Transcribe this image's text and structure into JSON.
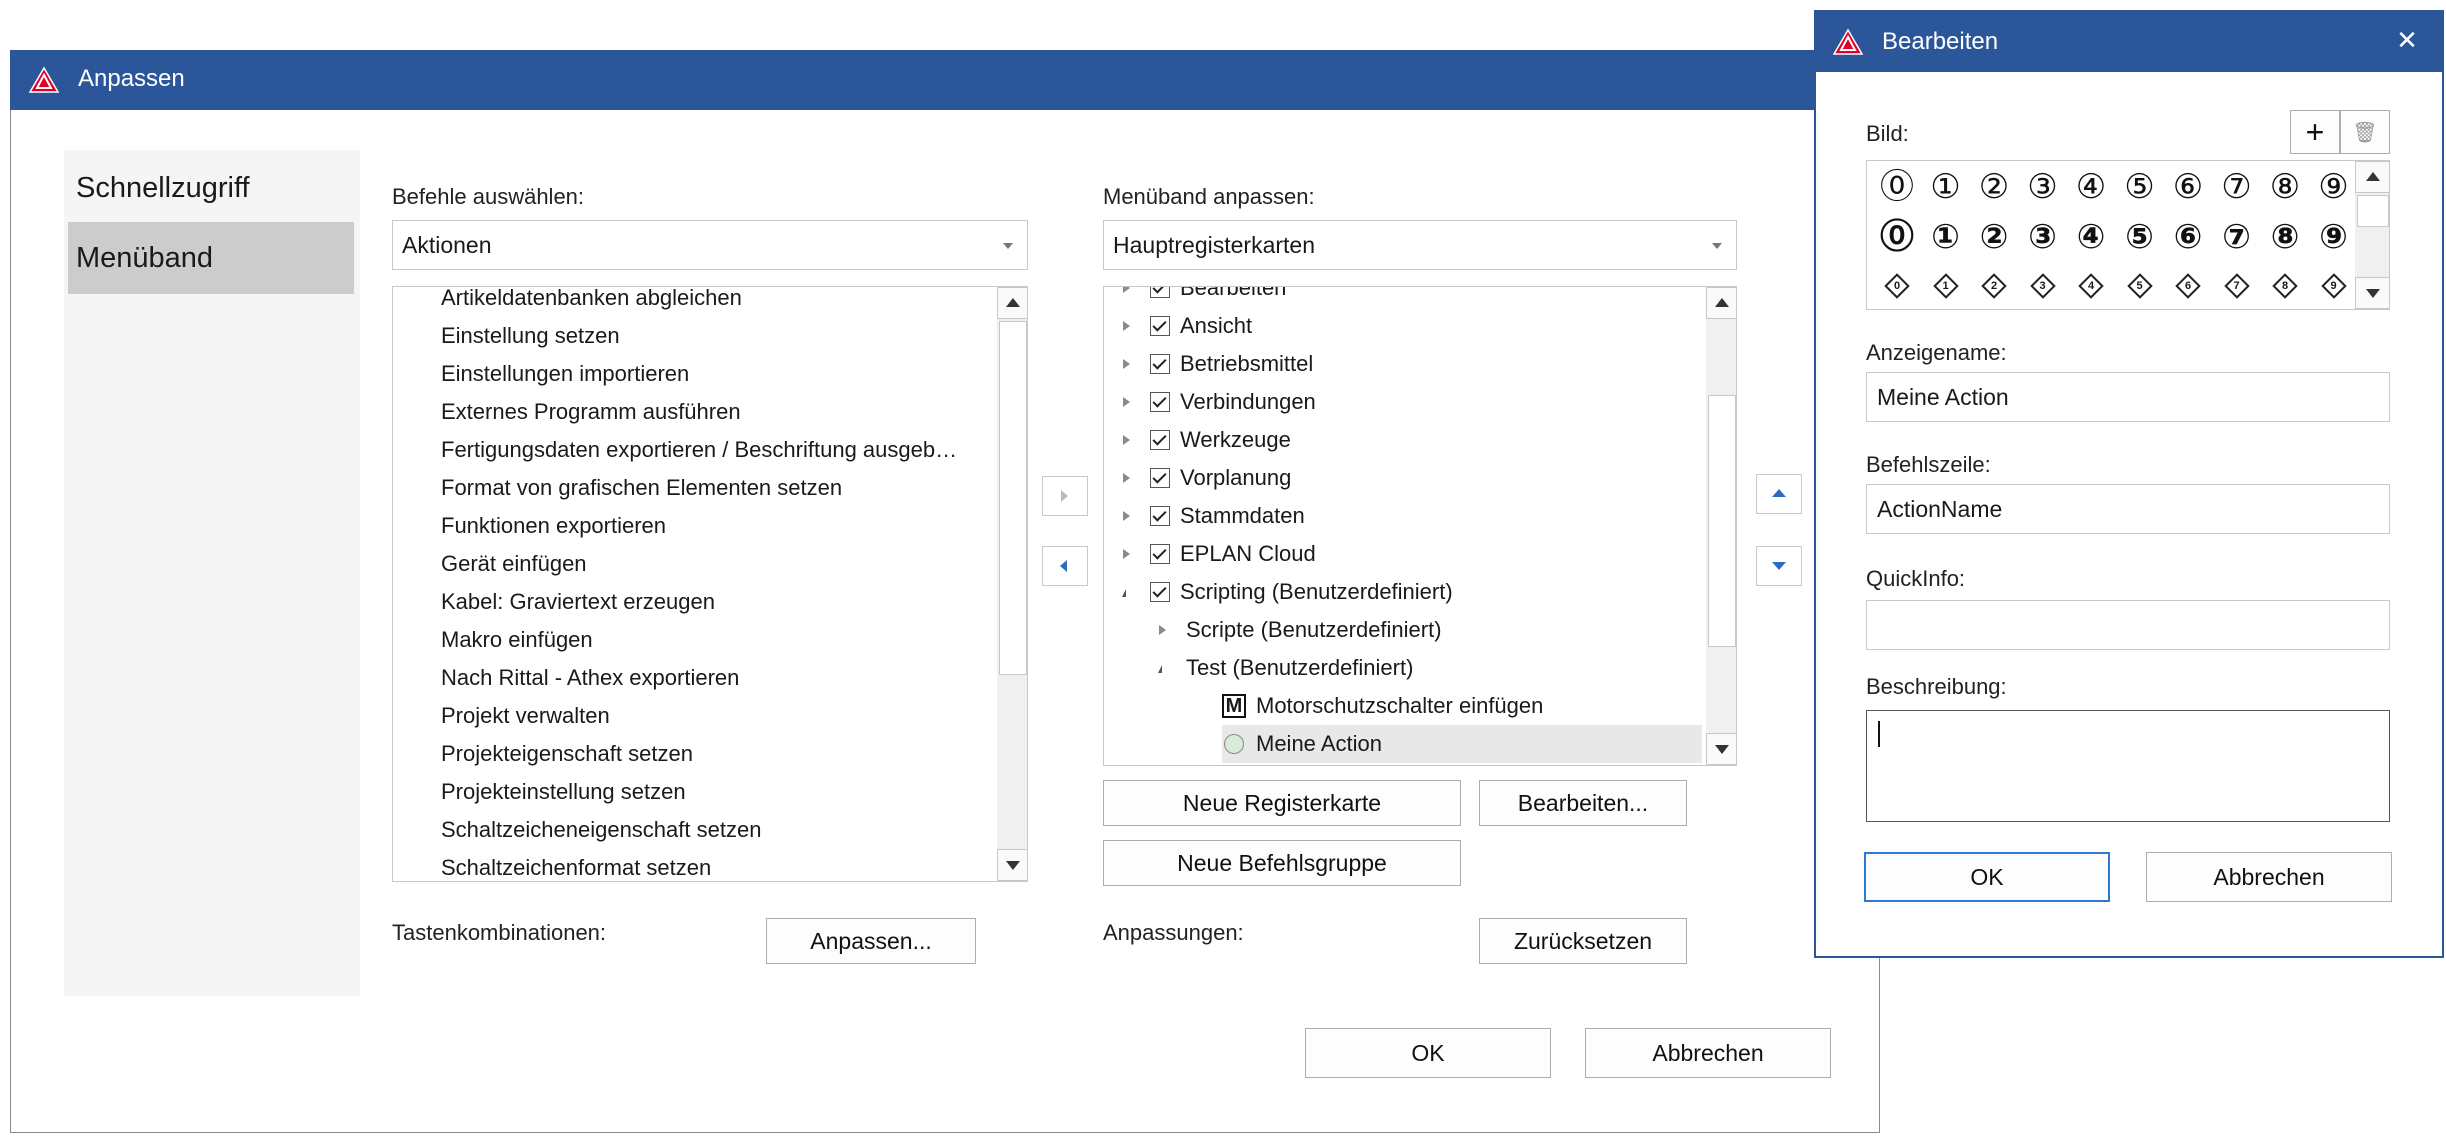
{
  "main_dialog": {
    "title": "Anpassen",
    "nav": [
      {
        "label": "Schnellzugriff",
        "selected": false
      },
      {
        "label": "Menüband",
        "selected": true
      }
    ],
    "commands": {
      "label": "Befehle auswählen:",
      "combo_value": "Aktionen",
      "items": [
        "Artikeldatenbanken abgleichen",
        "Einstellung setzen",
        "Einstellungen importieren",
        "Externes Programm ausführen",
        "Fertigungsdaten exportieren / Beschriftung ausgeb…",
        "Format von grafischen Elementen setzen",
        "Funktionen exportieren",
        "Gerät einfügen",
        "Kabel: Graviertext erzeugen",
        "Makro einfügen",
        "Nach Rittal - Athex exportieren",
        "Projekt verwalten",
        "Projekteigenschaft setzen",
        "Projekteinstellung setzen",
        "Schaltzeicheneigenschaft setzen",
        "Schaltzeichenformat setzen"
      ]
    },
    "ribbon": {
      "label": "Menüband anpassen:",
      "combo_value": "Hauptregisterkarten",
      "tree": [
        {
          "label": "Bearbeiten",
          "level": 0,
          "expander": "closed",
          "checked": true
        },
        {
          "label": "Ansicht",
          "level": 0,
          "expander": "closed",
          "checked": true
        },
        {
          "label": "Betriebsmittel",
          "level": 0,
          "expander": "closed",
          "checked": true
        },
        {
          "label": "Verbindungen",
          "level": 0,
          "expander": "closed",
          "checked": true
        },
        {
          "label": "Werkzeuge",
          "level": 0,
          "expander": "closed",
          "checked": true
        },
        {
          "label": "Vorplanung",
          "level": 0,
          "expander": "closed",
          "checked": true
        },
        {
          "label": "Stammdaten",
          "level": 0,
          "expander": "closed",
          "checked": true
        },
        {
          "label": "EPLAN Cloud",
          "level": 0,
          "expander": "closed",
          "checked": true
        },
        {
          "label": "Scripting (Benutzerdefiniert)",
          "level": 0,
          "expander": "open",
          "checked": true
        },
        {
          "label": "Scripte (Benutzerdefiniert)",
          "level": 1,
          "expander": "closed"
        },
        {
          "label": "Test (Benutzerdefiniert)",
          "level": 1,
          "expander": "open"
        },
        {
          "label": "Motorschutzschalter einfügen",
          "level": 2,
          "icon": "M"
        },
        {
          "label": "Meine Action",
          "level": 2,
          "icon": "circle",
          "selected": true
        }
      ]
    },
    "buttons": {
      "new_tab": "Neue Registerkarte",
      "edit": "Bearbeiten...",
      "new_group": "Neue Befehlsgruppe",
      "shortcuts_label": "Tastenkombinationen:",
      "shortcuts_button": "Anpassen...",
      "customizations_label": "Anpassungen:",
      "reset": "Zurücksetzen",
      "ok": "OK",
      "cancel": "Abbrechen"
    }
  },
  "edit_dialog": {
    "title": "Bearbeiten",
    "close_glyph": "✕",
    "image_label": "Bild:",
    "add_glyph": "+",
    "delete_glyph": "🗑",
    "icon_rows": [
      [
        "⓪",
        "①",
        "②",
        "③",
        "④",
        "⑤",
        "⑥",
        "⑦",
        "⑧",
        "⑨"
      ],
      [
        "⓪",
        "①",
        "②",
        "③",
        "④",
        "⑤",
        "⑥",
        "⑦",
        "⑧",
        "⑨"
      ],
      [
        "0",
        "1",
        "2",
        "3",
        "4",
        "5",
        "6",
        "7",
        "8",
        "9"
      ]
    ],
    "display_name_label": "Anzeigename:",
    "display_name_value": "Meine Action",
    "command_line_label": "Befehlszeile:",
    "command_line_value": "ActionName",
    "quickinfo_label": "QuickInfo:",
    "quickinfo_value": "",
    "description_label": "Beschreibung:",
    "description_value": "",
    "ok": "OK",
    "cancel": "Abbrechen"
  },
  "colors": {
    "titlebar": "#2b579a",
    "accent": "#2b6cc4",
    "selected_nav": "#cccccc",
    "warning_icon": "#e0002a"
  }
}
